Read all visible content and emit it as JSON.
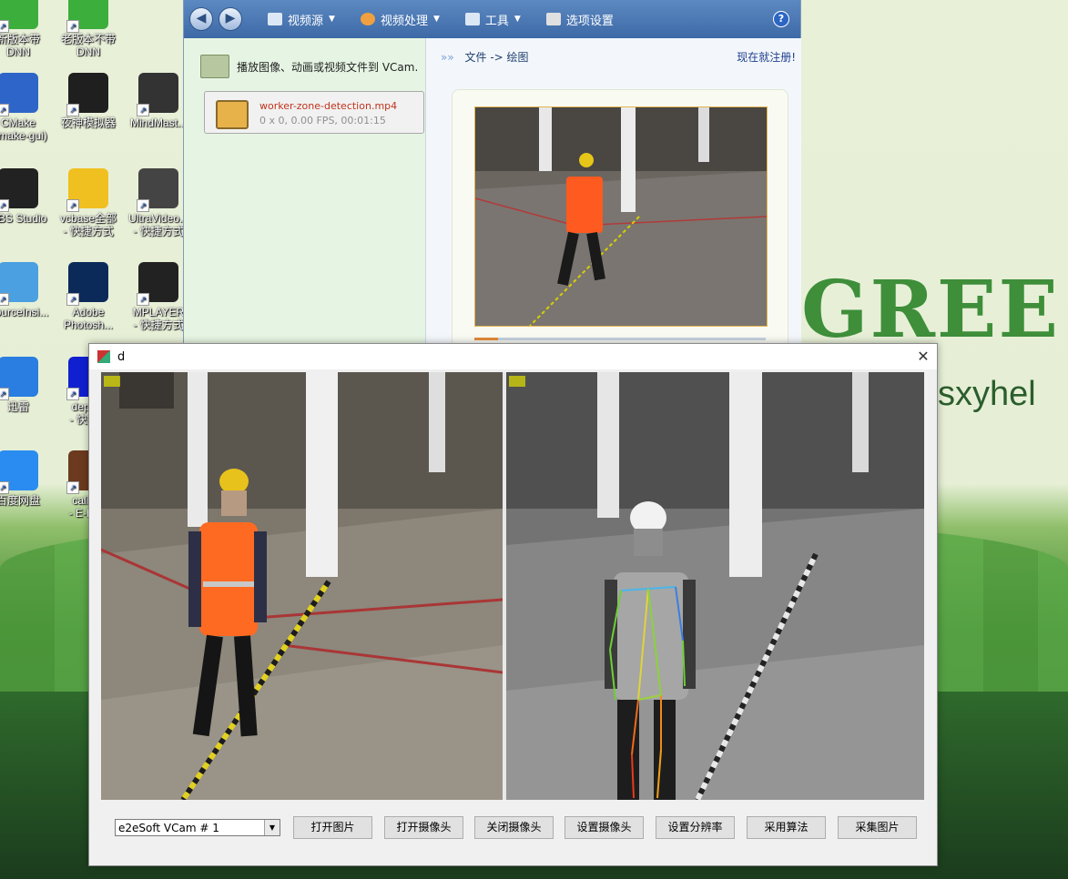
{
  "desktop": {
    "icons": [
      {
        "label": "新版本带\nDNN",
        "icon": "qt-icon",
        "color": "#3cae3c"
      },
      {
        "label": "老版本不带\nDNN",
        "icon": "qt-icon",
        "color": "#3cae3c"
      },
      {
        "label": "CMake\n(cmake-gui)",
        "icon": "cmake-icon",
        "color": "#2d66c8"
      },
      {
        "label": "夜神模拟器",
        "icon": "nox-icon",
        "color": "#1f1f1f"
      },
      {
        "label": "MindMast...",
        "icon": "mindmaster-icon",
        "color": "#333333"
      },
      {
        "label": "OBS Studio",
        "icon": "obs-icon",
        "color": "#222222"
      },
      {
        "label": "vcbase全部\n- 快捷方式",
        "icon": "help-doc-icon",
        "color": "#f0c020"
      },
      {
        "label": "UltraVideo...\n- 快捷方式",
        "icon": "ultravideo-icon",
        "color": "#444444"
      },
      {
        "label": "SourceInsi...",
        "icon": "sourceinsight-icon",
        "color": "#4aa0e0"
      },
      {
        "label": "Adobe\nPhotosh...",
        "icon": "photoshop-icon",
        "color": "#0b2a5a"
      },
      {
        "label": "MPLAYER\n- 快捷方式",
        "icon": "mplayer-icon",
        "color": "#222222"
      },
      {
        "label": "迅雷",
        "icon": "xunlei-icon",
        "color": "#2a7de1"
      },
      {
        "label": "depe...\n- 快捷...",
        "icon": "depends-icon",
        "color": "#1020d0"
      },
      {
        "label": "百度网盘",
        "icon": "baidu-netdisk-icon",
        "color": "#2a8cf0"
      },
      {
        "label": "calibre\n- E-bo...",
        "icon": "calibre-icon",
        "color": "#6b3a1f"
      }
    ],
    "wallpaper_text": "GREE",
    "wallpaper_sub": "sxyhel"
  },
  "vcam": {
    "menu": [
      {
        "label": "视频源",
        "icon": "video-source-icon"
      },
      {
        "label": "视频处理",
        "icon": "video-process-icon"
      },
      {
        "label": "工具",
        "icon": "tools-icon"
      },
      {
        "label": "选项设置",
        "icon": "settings-icon"
      }
    ],
    "help": "?",
    "tip": "播放图像、动画或视频文件到 VCam.",
    "file": {
      "name": "worker-zone-detection.mp4",
      "info": "0 x 0, 0.00 FPS, 00:01:15"
    },
    "breadcrumb": "文件 -> 绘图",
    "register": "现在就注册!",
    "seek_progress": 0.08
  },
  "dialog": {
    "title": "d",
    "close": "✕",
    "combo_value": "e2eSoft VCam # 1",
    "buttons": [
      "打开图片",
      "打开摄像头",
      "关闭摄像头",
      "设置摄像头",
      "设置分辨率",
      "采用算法",
      "采集图片"
    ]
  }
}
